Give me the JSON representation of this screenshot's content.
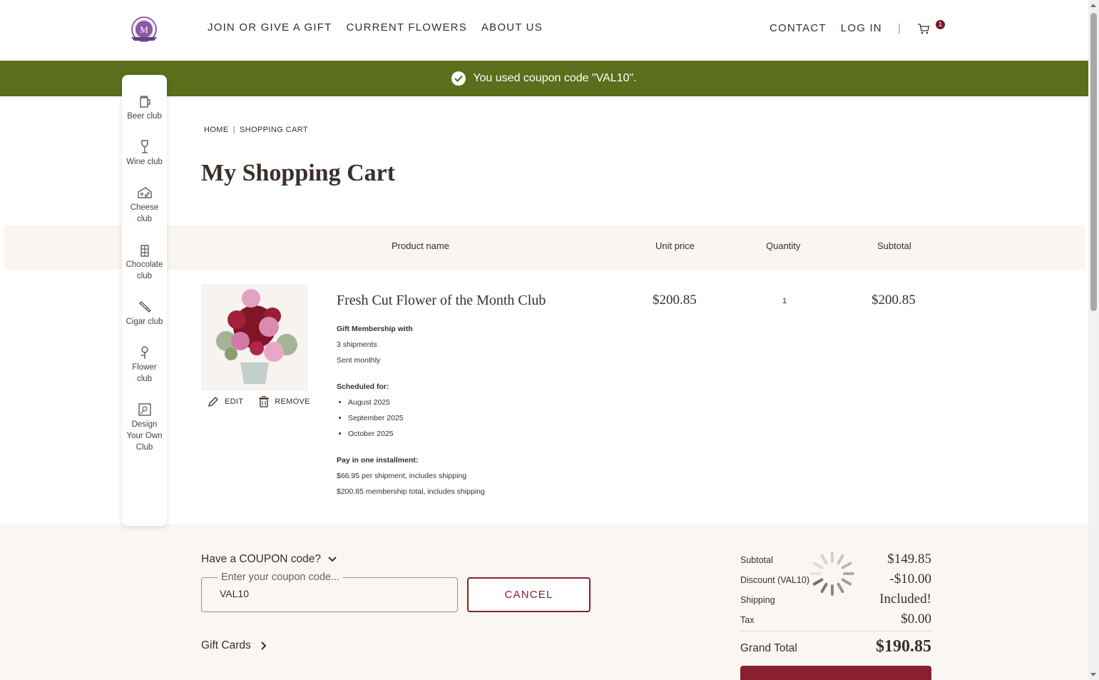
{
  "header": {
    "nav_left": [
      "JOIN OR GIVE A GIFT",
      "CURRENT FLOWERS",
      "ABOUT US"
    ],
    "contact": "CONTACT",
    "login": "LOG IN",
    "separator": "|",
    "cart_count": "1"
  },
  "banner": {
    "message": "You used coupon code \"VAL10\"."
  },
  "sidebar": {
    "items": [
      {
        "label": "Beer club",
        "icon": "beer-mug-icon"
      },
      {
        "label": "Wine club",
        "icon": "wine-glass-icon"
      },
      {
        "label": "Cheese club",
        "icon": "cheese-icon"
      },
      {
        "label": "Chocolate club",
        "icon": "chocolate-icon"
      },
      {
        "label": "Cigar club",
        "icon": "cigar-icon"
      },
      {
        "label": "Flower club",
        "icon": "flower-icon"
      },
      {
        "label": "Design Your Own Club",
        "icon": "design-icon"
      }
    ]
  },
  "breadcrumb": {
    "home": "HOME",
    "separator": "|",
    "current": "SHOPPING CART"
  },
  "page_title": "My Shopping Cart",
  "table": {
    "headers": {
      "product": "Product name",
      "unit_price": "Unit price",
      "quantity": "Quantity",
      "subtotal": "Subtotal"
    }
  },
  "item": {
    "name": "Fresh Cut Flower of the Month Club",
    "unit_price": "$200.85",
    "quantity": "1",
    "subtotal": "$200.85",
    "edit_label": "EDIT",
    "remove_label": "REMOVE",
    "membership_title": "Gift Membership with",
    "shipments": "3 shipments",
    "frequency": "Sent monthly",
    "scheduled_title": "Scheduled for:",
    "schedule": [
      "August 2025",
      "September 2025",
      "October 2025"
    ],
    "pay_title": "Pay in one installment:",
    "per_shipment": "$66.95 per shipment, includes shipping",
    "total_line": "$200.85 membership total, includes shipping"
  },
  "coupon": {
    "toggle_label": "Have a COUPON code?",
    "legend": "Enter your coupon code...",
    "value": "VAL10",
    "cancel_label": "CANCEL"
  },
  "gift_cards_label": "Gift Cards",
  "summary": {
    "subtotal_label": "Subtotal",
    "subtotal_value": "$149.85",
    "discount_label": "Discount (VAL10)",
    "discount_value": "-$10.00",
    "shipping_label": "Shipping",
    "shipping_value": "Included!",
    "tax_label": "Tax",
    "tax_value": "$0.00",
    "grand_label": "Grand Total",
    "grand_value": "$190.85"
  },
  "colors": {
    "banner_green": "#5a6e1c",
    "brand_maroon": "#8a1f2e",
    "text_brown": "#3a2f2a",
    "panel_beige": "#faf7f3"
  }
}
